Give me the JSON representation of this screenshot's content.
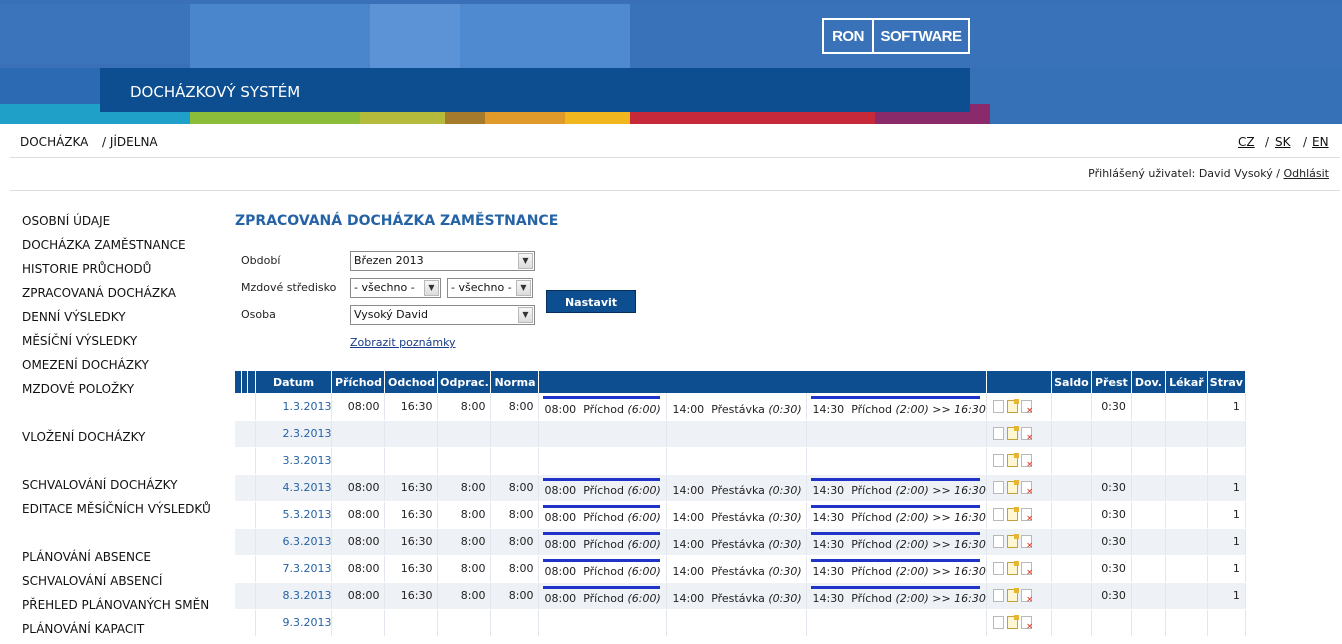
{
  "header": {
    "logo_left": "RON",
    "logo_right": "SOFTWARE",
    "system_title": "DOCHÁZKOVÝ SYSTÉM"
  },
  "colors": {
    "brand_blue": "#0d4e91",
    "link_blue": "#2563a6",
    "event_bar": "#1f33c9"
  },
  "topnav": {
    "modules": [
      "DOCHÁZKA",
      "/ JÍDELNA"
    ],
    "languages": [
      "CZ",
      "SK",
      "EN"
    ],
    "lang_sep": "/"
  },
  "user": {
    "label": "Přihlášený uživatel: David Vysoký /",
    "logout": "Odhlásit"
  },
  "sidebar": {
    "items": [
      "OSOBNÍ ÚDAJE",
      "DOCHÁZKA ZAMĚSTNANCE",
      "HISTORIE PRŮCHODŮ",
      "ZPRACOVANÁ DOCHÁZKA",
      "DENNÍ VÝSLEDKY",
      "MĚSÍČNÍ VÝSLEDKY",
      "OMEZENÍ DOCHÁZKY",
      "MZDOVÉ POLOŽKY",
      "VLOŽENÍ DOCHÁZKY",
      "SCHVALOVÁNÍ DOCHÁZKY",
      "EDITACE MĚSÍČNÍCH VÝSLEDKŮ",
      "PLÁNOVÁNÍ ABSENCE",
      "SCHVALOVÁNÍ ABSENCÍ",
      "PŘEHLED PLÁNOVANÝCH SMĚN",
      "PLÁNOVÁNÍ KAPACIT"
    ]
  },
  "main": {
    "title": "ZPRACOVANÁ DOCHÁZKA ZAMĚSTNANCE",
    "filters": {
      "period_label": "Období",
      "period_value": "Březen 2013",
      "center_label": "Mzdové středisko",
      "center_value_1": "- všechno -",
      "center_value_2": "- všechno -",
      "person_label": "Osoba",
      "person_value": "Vysoký David",
      "submit": "Nastavit"
    },
    "notes_link": "Zobrazit poznámky",
    "table": {
      "headers": [
        "Datum",
        "Příchod",
        "Odchod",
        "Odprac.",
        "Norma",
        "",
        "",
        "Saldo",
        "Přest",
        "Dov.",
        "Lékař",
        "Strav"
      ],
      "rows": [
        {
          "date": "1.3.2013",
          "prichod": "08:00",
          "odchod": "16:30",
          "odprac": "8:00",
          "norma": "8:00",
          "events": true,
          "prest": "0:30",
          "strav": "1"
        },
        {
          "date": "2.3.2013",
          "prichod": "",
          "odchod": "",
          "odprac": "",
          "norma": "",
          "events": false,
          "prest": "",
          "strav": ""
        },
        {
          "date": "3.3.2013",
          "prichod": "",
          "odchod": "",
          "odprac": "",
          "norma": "",
          "events": false,
          "prest": "",
          "strav": ""
        },
        {
          "date": "4.3.2013",
          "prichod": "08:00",
          "odchod": "16:30",
          "odprac": "8:00",
          "norma": "8:00",
          "events": true,
          "prest": "0:30",
          "strav": "1"
        },
        {
          "date": "5.3.2013",
          "prichod": "08:00",
          "odchod": "16:30",
          "odprac": "8:00",
          "norma": "8:00",
          "events": true,
          "prest": "0:30",
          "strav": "1"
        },
        {
          "date": "6.3.2013",
          "prichod": "08:00",
          "odchod": "16:30",
          "odprac": "8:00",
          "norma": "8:00",
          "events": true,
          "prest": "0:30",
          "strav": "1"
        },
        {
          "date": "7.3.2013",
          "prichod": "08:00",
          "odchod": "16:30",
          "odprac": "8:00",
          "norma": "8:00",
          "events": true,
          "prest": "0:30",
          "strav": "1"
        },
        {
          "date": "8.3.2013",
          "prichod": "08:00",
          "odchod": "16:30",
          "odprac": "8:00",
          "norma": "8:00",
          "events": true,
          "prest": "0:30",
          "strav": "1"
        },
        {
          "date": "9.3.2013",
          "prichod": "",
          "odchod": "",
          "odprac": "",
          "norma": "",
          "events": false,
          "prest": "",
          "strav": ""
        }
      ],
      "events": [
        {
          "time": "08:00",
          "type": "Příchod",
          "dur": "(6:00)",
          "suffix": ""
        },
        {
          "time": "14:00",
          "type": "Přestávka",
          "dur": "(0:30)",
          "suffix": ""
        },
        {
          "time": "14:30",
          "type": "Příchod",
          "dur": "(2:00)",
          "suffix": ">> 16:30"
        }
      ]
    }
  }
}
